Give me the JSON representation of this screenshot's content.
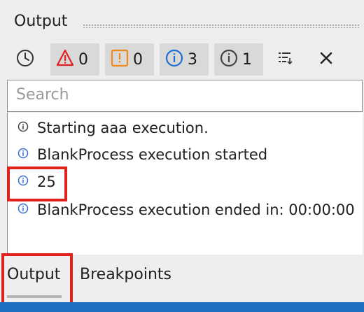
{
  "header": {
    "title": "Output"
  },
  "toolbar": {
    "clock_icon": "clock-icon",
    "filters": [
      {
        "icon": "error-icon",
        "count": "0",
        "color": "#e02020"
      },
      {
        "icon": "warning-icon",
        "count": "0",
        "color": "#ef8a1a"
      },
      {
        "icon": "info-icon",
        "count": "3",
        "color": "#1f6fd0"
      },
      {
        "icon": "trace-icon",
        "count": "1",
        "color": "#444444"
      }
    ],
    "settings_icon": "list-settings-icon",
    "close_icon": "close-icon"
  },
  "search": {
    "placeholder": "Search",
    "value": ""
  },
  "log": [
    {
      "level": "trace",
      "text": "Starting aaa execution."
    },
    {
      "level": "info",
      "text": "BlankProcess execution started"
    },
    {
      "level": "info",
      "text": "25"
    },
    {
      "level": "info",
      "text": "BlankProcess execution ended in: 00:00:00"
    }
  ],
  "tabs": [
    {
      "label": "Output",
      "active": true
    },
    {
      "label": "Breakpoints",
      "active": false
    }
  ],
  "colors": {
    "highlight": "#e12020",
    "status_bar": "#1f6fc4",
    "info": "#3b6fd6"
  }
}
